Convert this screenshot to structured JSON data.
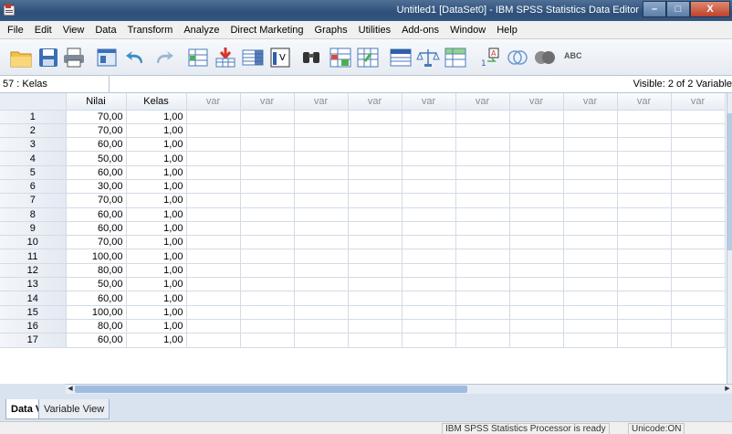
{
  "window": {
    "title": "Untitled1 [DataSet0] - IBM SPSS Statistics Data Editor",
    "buttons": {
      "minimize": "–",
      "maximize": "□",
      "close": "X"
    }
  },
  "menu": [
    "File",
    "Edit",
    "View",
    "Data",
    "Transform",
    "Analyze",
    "Direct Marketing",
    "Graphs",
    "Utilities",
    "Add-ons",
    "Window",
    "Help"
  ],
  "toolbar": {
    "icons": [
      "open-icon",
      "save-icon",
      "print-icon",
      "dialog-recall-icon",
      "undo-icon",
      "redo-icon",
      "goto-case-icon",
      "goto-variable-icon",
      "variables-icon",
      "run-descriptives-icon",
      "find-icon",
      "insert-cases-icon",
      "insert-variable-icon",
      "split-file-icon",
      "weight-cases-icon",
      "select-cases-icon",
      "value-labels-icon",
      "use-variable-sets-icon",
      "show-all-variables-icon",
      "spell-check-icon"
    ],
    "spell_label": "ABC"
  },
  "cell_ref": "57 : Kelas",
  "visible_text": "Visible: 2 of 2 Variable",
  "grid": {
    "columns": [
      "Nilai",
      "Kelas",
      "var",
      "var",
      "var",
      "var",
      "var",
      "var",
      "var",
      "var",
      "var",
      "var"
    ],
    "rows": [
      {
        "n": "1",
        "nilai": "70,00",
        "kelas": "1,00"
      },
      {
        "n": "2",
        "nilai": "70,00",
        "kelas": "1,00"
      },
      {
        "n": "3",
        "nilai": "60,00",
        "kelas": "1,00"
      },
      {
        "n": "4",
        "nilai": "50,00",
        "kelas": "1,00"
      },
      {
        "n": "5",
        "nilai": "60,00",
        "kelas": "1,00"
      },
      {
        "n": "6",
        "nilai": "30,00",
        "kelas": "1,00"
      },
      {
        "n": "7",
        "nilai": "70,00",
        "kelas": "1,00"
      },
      {
        "n": "8",
        "nilai": "60,00",
        "kelas": "1,00"
      },
      {
        "n": "9",
        "nilai": "60,00",
        "kelas": "1,00"
      },
      {
        "n": "10",
        "nilai": "70,00",
        "kelas": "1,00"
      },
      {
        "n": "11",
        "nilai": "100,00",
        "kelas": "1,00"
      },
      {
        "n": "12",
        "nilai": "80,00",
        "kelas": "1,00"
      },
      {
        "n": "13",
        "nilai": "50,00",
        "kelas": "1,00"
      },
      {
        "n": "14",
        "nilai": "60,00",
        "kelas": "1,00"
      },
      {
        "n": "15",
        "nilai": "100,00",
        "kelas": "1,00"
      },
      {
        "n": "16",
        "nilai": "80,00",
        "kelas": "1,00"
      },
      {
        "n": "17",
        "nilai": "60,00",
        "kelas": "1,00"
      }
    ]
  },
  "tabs": {
    "data_view": "Data View",
    "variable_view": "Variable View"
  },
  "status": {
    "processor": "IBM SPSS Statistics Processor is ready",
    "unicode": "Unicode:ON"
  }
}
